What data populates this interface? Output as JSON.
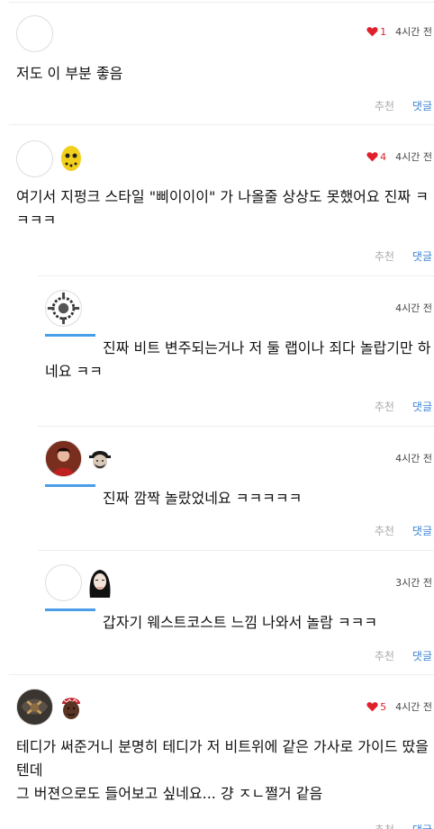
{
  "comments": [
    {
      "likes": "1",
      "time": "4시간 전",
      "text": "저도 이 부분 좋음",
      "rec": "추천",
      "reply": "댓글"
    },
    {
      "likes": "4",
      "time": "4시간 전",
      "text": "여기서 지펑크 스타일 \"삐이이이\" 가 나올줄 상상도 못했어요 진짜 ㅋㅋㅋㅋ",
      "rec": "추천",
      "reply": "댓글"
    },
    {
      "time": "4시간 전",
      "text": "진짜 비트 변주되는거나 저 둘 랩이나 죄다 놀랍기만 하네요 ㅋㅋ",
      "rec": "추천",
      "reply": "댓글"
    },
    {
      "time": "4시간 전",
      "text": "진짜 깜짝 놀랐었네요 ㅋㅋㅋㅋㅋ",
      "rec": "추천",
      "reply": "댓글"
    },
    {
      "time": "3시간 전",
      "text": "갑자기 웨스트코스트 느낌 나와서 놀람 ㅋㅋㅋ",
      "rec": "추천",
      "reply": "댓글"
    },
    {
      "likes": "5",
      "time": "4시간 전",
      "text1": "테디가 써준거니 분명히 테디가 저 비트위에 같은 가사로 가이드 땄을텐데",
      "text2": "그 버젼으로도 들어보고 싶네요... 걍 ㅈㄴ쩔거 같음",
      "rec": "추천",
      "reply": "댓글"
    }
  ],
  "colors": {
    "heart": "#e0202a",
    "reply_link": "#3b86d6",
    "indent_bar": "#4a9ee8"
  }
}
